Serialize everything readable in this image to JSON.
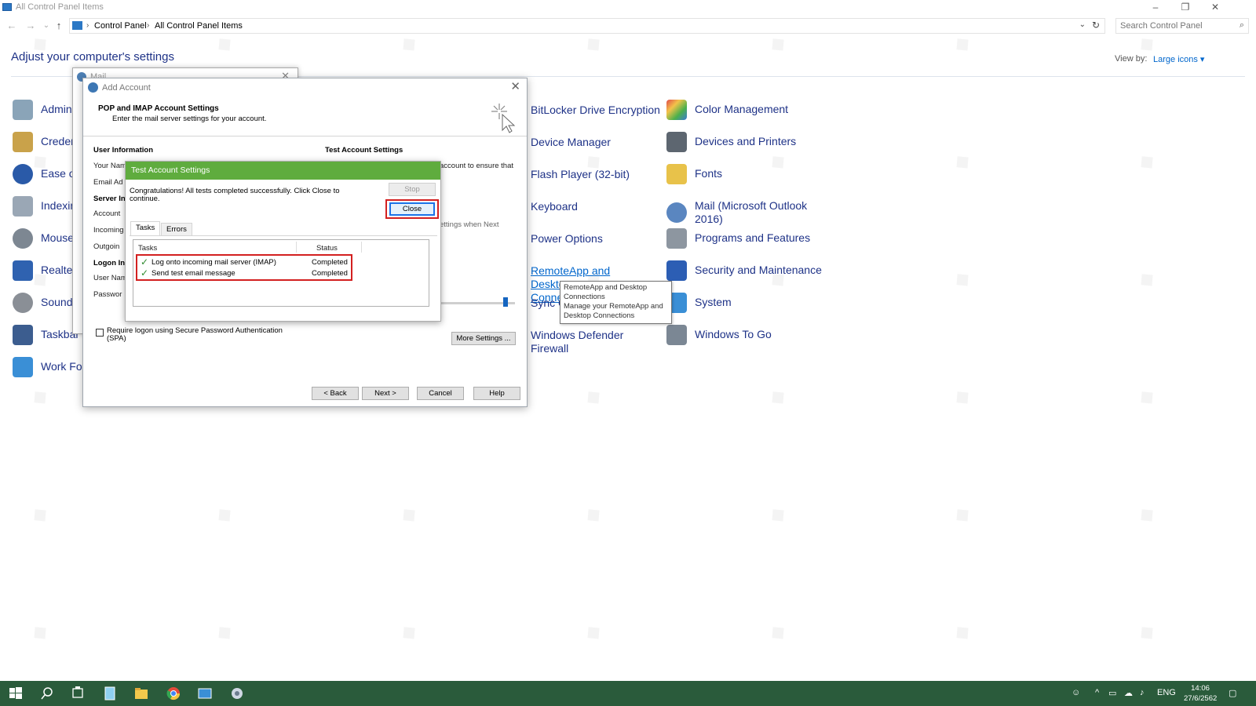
{
  "window": {
    "title": "All Control Panel Items",
    "minimize": "–",
    "restore": "❐",
    "close": "✕"
  },
  "nav": {
    "back": "←",
    "forward": "→",
    "recent": "⌄",
    "up": "↑",
    "breadcrumb": [
      "Control Panel",
      "All Control Panel Items"
    ],
    "separator": "›",
    "dropdown": "⌄",
    "refresh": "↻"
  },
  "search": {
    "placeholder": "Search Control Panel",
    "icon": "search-icon"
  },
  "header": {
    "title": "Adjust your computer's settings",
    "view_by_label": "View by:",
    "view_by_value": "Large icons ▾"
  },
  "control_panel_items": {
    "left_column": [
      "Admini",
      "Creden",
      "Ease of",
      "Indexin",
      "Mouse",
      "Realtek",
      "Sound",
      "Taskbar a",
      "Work Fol"
    ],
    "col3": [
      "BitLocker Drive Encryption",
      "Device Manager",
      "Flash Player (32-bit)",
      "Keyboard",
      "Power Options",
      "RemoteApp and Desktop\nConnections",
      "Sync C",
      "Windows Defender\nFirewall"
    ],
    "col4": [
      "Color Management",
      "Devices and Printers",
      "Fonts",
      "Mail (Microsoft Outlook\n2016)",
      "Programs and Features",
      "Security and Maintenance",
      "System",
      "Windows To Go"
    ]
  },
  "mail_window": {
    "title": "Mail",
    "close": "✕"
  },
  "add_account": {
    "title": "Add Account",
    "close": "✕",
    "heading": "POP and IMAP Account Settings",
    "subheading": "Enter the mail server settings for your account.",
    "user_info_header": "User Information",
    "test_header": "Test Account Settings",
    "fields": [
      "Your Nam",
      "Email Ad",
      "Server In",
      "Account",
      "Incoming",
      "Outgoin",
      "Logon In",
      "User Nam",
      "Passwor"
    ],
    "bg_text_1": "account to ensure that",
    "bg_text_2": "ettings when Next",
    "spa_label": "Require logon using Secure Password Authentication (SPA)",
    "more_settings": "More Settings ...",
    "back": "< Back",
    "next": "Next >",
    "cancel": "Cancel",
    "help": "Help"
  },
  "test_dialog": {
    "title": "Test Account Settings",
    "message": "Congratulations! All tests completed successfully. Click Close to continue.",
    "stop": "Stop",
    "close": "Close",
    "tabs": [
      "Tasks",
      "Errors"
    ],
    "columns": [
      "Tasks",
      "Status"
    ],
    "rows": [
      {
        "task": "Log onto incoming mail server (IMAP)",
        "status": "Completed"
      },
      {
        "task": "Send test email message",
        "status": "Completed"
      }
    ]
  },
  "tooltip": {
    "title": "RemoteApp and Desktop Connections",
    "body": "Manage your RemoteApp and Desktop Connections"
  },
  "taskbar": {
    "language": "ENG",
    "time": "14:06",
    "date": "27/6/2562"
  },
  "colors": {
    "accent_link": "#1e3287",
    "dialog_header_green": "#5fac3e",
    "highlight_red": "#d32020",
    "taskbar": "#2a5b3b"
  }
}
